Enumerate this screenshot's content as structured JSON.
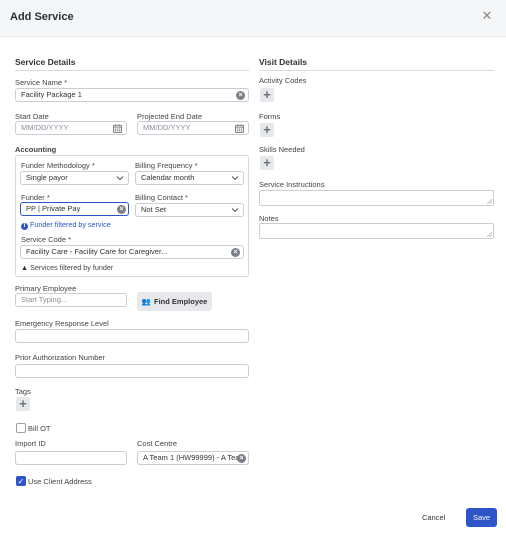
{
  "header": {
    "title": "Add Service",
    "close_icon": "close-icon"
  },
  "service_details": {
    "title": "Service Details",
    "service_name_label": "Service Name *",
    "service_name_value": "Facility Package 1",
    "start_date_label": "Start Date",
    "start_date_placeholder": "MM/DD/YYYY",
    "end_date_label": "Projected End Date",
    "end_date_placeholder": "MM/DD/YYYY"
  },
  "accounting": {
    "title": "Accounting",
    "funder_methodology_label": "Funder Methodology *",
    "funder_methodology_value": "Single payor",
    "billing_frequency_label": "Billing Frequency *",
    "billing_frequency_value": "Calendar month",
    "funder_label": "Funder *",
    "funder_value": "PP | Private Pay",
    "billing_contact_label": "Billing Contact *",
    "billing_contact_value": "Not Set",
    "funder_hint": "Funder filtered by service",
    "service_code_label": "Service Code *",
    "service_code_value": "Facility Care - Facility Care for Caregiver...",
    "service_code_hint": "Services filtered by funder"
  },
  "primary_employee": {
    "label": "Primary Employee",
    "placeholder": "Start Typing...",
    "find_button": "Find Employee"
  },
  "emergency_label": "Emergency Response Level",
  "prior_auth_label": "Prior Authorization Number",
  "tags_label": "Tags",
  "bill_ot_label": "Bill OT",
  "import_id_label": "Import ID",
  "cost_centre": {
    "label": "Cost Centre",
    "value": "A Team 1 (HW99999) - A Tea"
  },
  "use_client_address_label": "Use Client Address",
  "visit_details": {
    "title": "Visit Details",
    "activity_codes_label": "Activity Codes",
    "forms_label": "Forms",
    "skills_label": "Skills Needed",
    "service_instructions_label": "Service Instructions",
    "notes_label": "Notes"
  },
  "footer": {
    "cancel": "Cancel",
    "save": "Save"
  },
  "colors": {
    "accent": "#2d55c9",
    "header_bg": "#f5f6f7",
    "border": "#c9ced6"
  }
}
